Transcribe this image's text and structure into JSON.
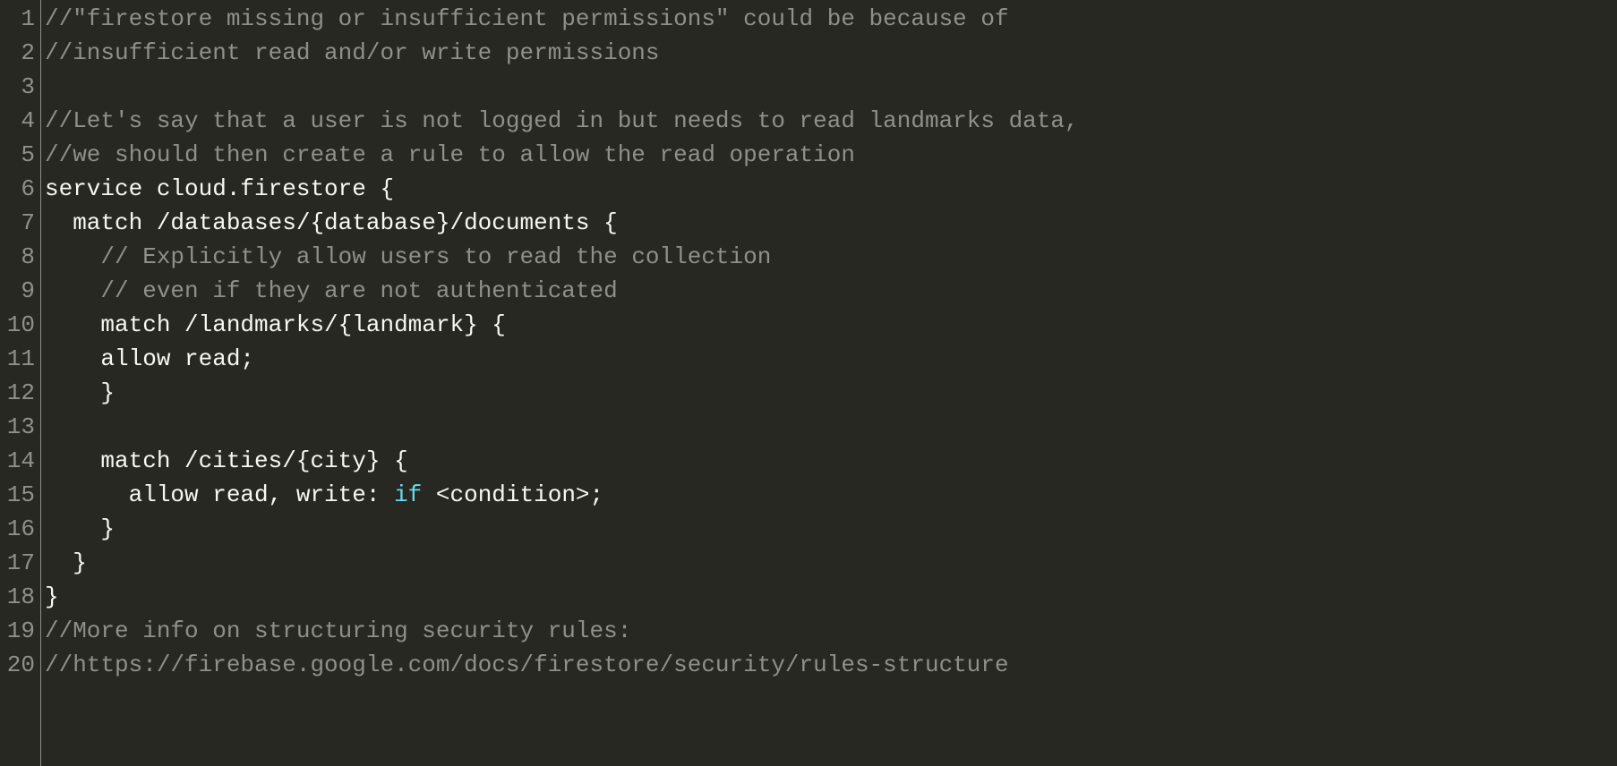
{
  "editor": {
    "theme": "monokai",
    "language": "firestore-rules",
    "lines": [
      {
        "num": "1",
        "tokens": [
          {
            "cls": "tok-comment",
            "text": "//\"firestore missing or insufficient permissions\" could be because of"
          }
        ]
      },
      {
        "num": "2",
        "tokens": [
          {
            "cls": "tok-comment",
            "text": "//insufficient read and/or write permissions"
          }
        ]
      },
      {
        "num": "3",
        "tokens": [
          {
            "cls": "tok-plain",
            "text": ""
          }
        ]
      },
      {
        "num": "4",
        "tokens": [
          {
            "cls": "tok-comment",
            "text": "//Let's say that a user is not logged in but needs to read landmarks data,"
          }
        ]
      },
      {
        "num": "5",
        "tokens": [
          {
            "cls": "tok-comment",
            "text": "//we should then create a rule to allow the read operation"
          }
        ]
      },
      {
        "num": "6",
        "tokens": [
          {
            "cls": "tok-plain",
            "text": "service cloud.firestore {"
          }
        ]
      },
      {
        "num": "7",
        "tokens": [
          {
            "cls": "tok-plain",
            "text": "  match /databases/{database}/documents {"
          }
        ]
      },
      {
        "num": "8",
        "tokens": [
          {
            "cls": "tok-plain",
            "text": "    "
          },
          {
            "cls": "tok-comment",
            "text": "// Explicitly allow users to read the collection"
          }
        ]
      },
      {
        "num": "9",
        "tokens": [
          {
            "cls": "tok-plain",
            "text": "    "
          },
          {
            "cls": "tok-comment",
            "text": "// even if they are not authenticated"
          }
        ]
      },
      {
        "num": "10",
        "tokens": [
          {
            "cls": "tok-plain",
            "text": "    match /landmarks/{landmark} {"
          }
        ]
      },
      {
        "num": "11",
        "tokens": [
          {
            "cls": "tok-plain",
            "text": "    allow read;"
          }
        ]
      },
      {
        "num": "12",
        "tokens": [
          {
            "cls": "tok-plain",
            "text": "    }"
          }
        ]
      },
      {
        "num": "13",
        "tokens": [
          {
            "cls": "tok-plain",
            "text": ""
          }
        ]
      },
      {
        "num": "14",
        "tokens": [
          {
            "cls": "tok-plain",
            "text": "    match /cities/{city} {"
          }
        ]
      },
      {
        "num": "15",
        "tokens": [
          {
            "cls": "tok-plain",
            "text": "      allow read, write: "
          },
          {
            "cls": "tok-keyword",
            "text": "if"
          },
          {
            "cls": "tok-plain",
            "text": " <condition>;"
          }
        ]
      },
      {
        "num": "16",
        "tokens": [
          {
            "cls": "tok-plain",
            "text": "    }"
          }
        ]
      },
      {
        "num": "17",
        "tokens": [
          {
            "cls": "tok-plain",
            "text": "  }"
          }
        ]
      },
      {
        "num": "18",
        "tokens": [
          {
            "cls": "tok-plain",
            "text": "}"
          }
        ]
      },
      {
        "num": "19",
        "tokens": [
          {
            "cls": "tok-comment",
            "text": "//More info on structuring security rules:"
          }
        ]
      },
      {
        "num": "20",
        "tokens": [
          {
            "cls": "tok-comment",
            "text": "//https://firebase.google.com/docs/firestore/security/rules-structure"
          }
        ]
      }
    ]
  }
}
